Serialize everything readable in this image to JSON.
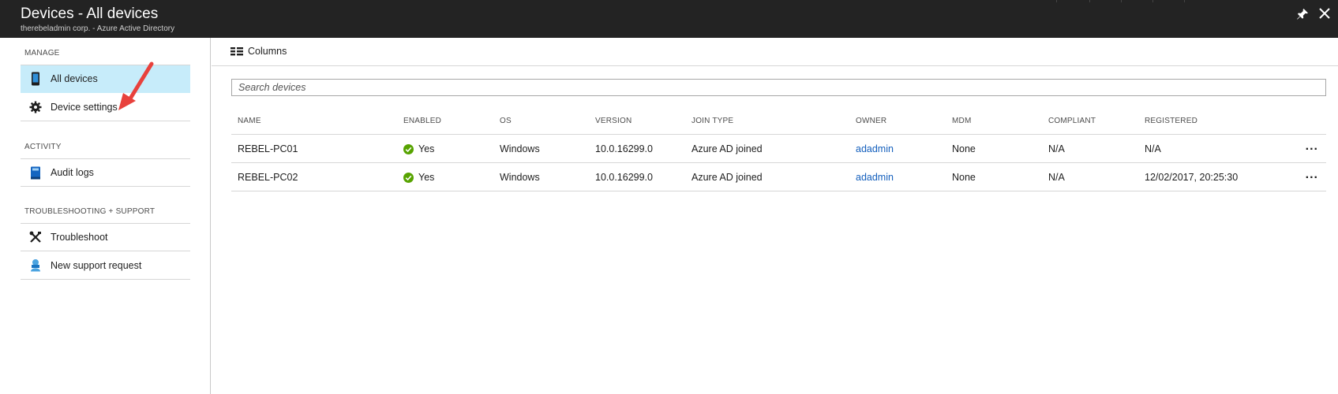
{
  "window": {
    "title": "Devices - All devices",
    "subtitle": "therebeladmin corp. - Azure Active Directory",
    "pin_icon": "pin-icon",
    "close_icon": "close-icon"
  },
  "leftnav": {
    "sections": [
      {
        "label": "MANAGE",
        "items": [
          {
            "label": "All devices",
            "icon": "device-icon",
            "active": true
          },
          {
            "label": "Device settings",
            "icon": "gear-icon",
            "active": false
          }
        ]
      },
      {
        "label": "ACTIVITY",
        "items": [
          {
            "label": "Audit logs",
            "icon": "book-icon",
            "active": false
          }
        ]
      },
      {
        "label": "TROUBLESHOOTING + SUPPORT",
        "items": [
          {
            "label": "Troubleshoot",
            "icon": "tools-icon",
            "active": false
          },
          {
            "label": "New support request",
            "icon": "support-person-icon",
            "active": false
          }
        ]
      }
    ]
  },
  "toolbar": {
    "columns_label": "Columns"
  },
  "search": {
    "placeholder": "Search devices",
    "value": ""
  },
  "table": {
    "columns": [
      "NAME",
      "ENABLED",
      "OS",
      "VERSION",
      "JOIN TYPE",
      "OWNER",
      "MDM",
      "COMPLIANT",
      "REGISTERED"
    ],
    "rows": [
      {
        "name": "REBEL-PC01",
        "enabled": "Yes",
        "os": "Windows",
        "version": "10.0.16299.0",
        "join_type": "Azure AD joined",
        "owner": "adadmin",
        "mdm": "None",
        "compliant": "N/A",
        "registered": "N/A",
        "more": "..."
      },
      {
        "name": "REBEL-PC02",
        "enabled": "Yes",
        "os": "Windows",
        "version": "10.0.16299.0",
        "join_type": "Azure AD joined",
        "owner": "adadmin",
        "mdm": "None",
        "compliant": "N/A",
        "registered": "12/02/2017, 20:25:30",
        "more": "..."
      }
    ]
  },
  "colors": {
    "titlebar_bg": "#232323",
    "active_item_bg": "#c7ecfa",
    "link": "#1560bd",
    "check_green": "#57a300",
    "annotation_arrow": "#e8413c"
  }
}
